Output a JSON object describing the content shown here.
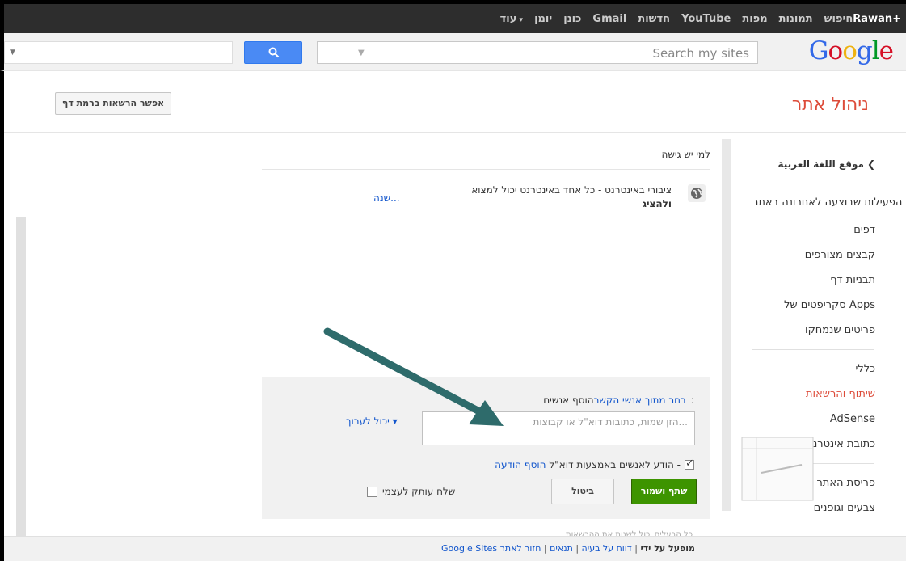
{
  "topbar": {
    "links": [
      "Rawan+",
      "חיפוש",
      "תמונות",
      "מפות",
      "YouTube",
      "חדשות",
      "Gmail",
      "כונן",
      "יומן",
      "עוד"
    ]
  },
  "search": {
    "placeholder": "Search my sites",
    "logo_letters": [
      "G",
      "o",
      "o",
      "g",
      "l",
      "e"
    ]
  },
  "page": {
    "title": "ניהול אתר",
    "permissions_button": "אפשר הרשאות ברמת דף"
  },
  "sidebar": {
    "site_name": "موقع اللغة العربية",
    "items": [
      "הפעילות שבוצעה לאחרונה באתר",
      "דפים",
      "קבצים מצורפים",
      "תבניות דף",
      "סקריפטים של Apps",
      "פריטים שנמחקו"
    ],
    "items2": [
      "כללי",
      "שיתוף והרשאות",
      "AdSense",
      "כתובת אינטרנט"
    ],
    "items3": [
      "פריסת האתר",
      "צבעים וגופנים"
    ]
  },
  "main": {
    "who_has_access": "למי יש גישה",
    "access_text": "ציבורי באינטרנט - כל אחד באינטרנט יכול למצוא",
    "access_bold": "ולהציג",
    "change_link": "שנה..."
  },
  "share": {
    "add_people_label": "הוסף אנשים:",
    "choose_contacts": "בחר מתוך אנשי הקשר",
    "email_placeholder": "הזן שמות, כתובות דוא\"ל או קבוצות...",
    "can_edit": "יכול לערוך",
    "notify_label": "הודע לאנשים באמצעות דוא\"ל -",
    "add_message": "הוסף הודעה",
    "share_save": "שתף ושמור",
    "cancel": "ביטול",
    "send_copy": "שלח עותק לעצמי",
    "notify_checked": true,
    "send_copy_checked": false
  },
  "hint_text": "כל הבעלים יכול לשנות את ההרשאות",
  "footer": {
    "report": "חזור לאתר",
    "terms": "תנאים",
    "abuse": "דווח על בעיה",
    "powered": "מופעל על ידי",
    "brand": "Google Sites"
  },
  "colors": {
    "accent_red": "#dd4b39",
    "link_blue": "#1155cc",
    "search_blue": "#4a8af4",
    "share_green": "#3d9400",
    "arrow_teal": "#2e6b6b"
  }
}
